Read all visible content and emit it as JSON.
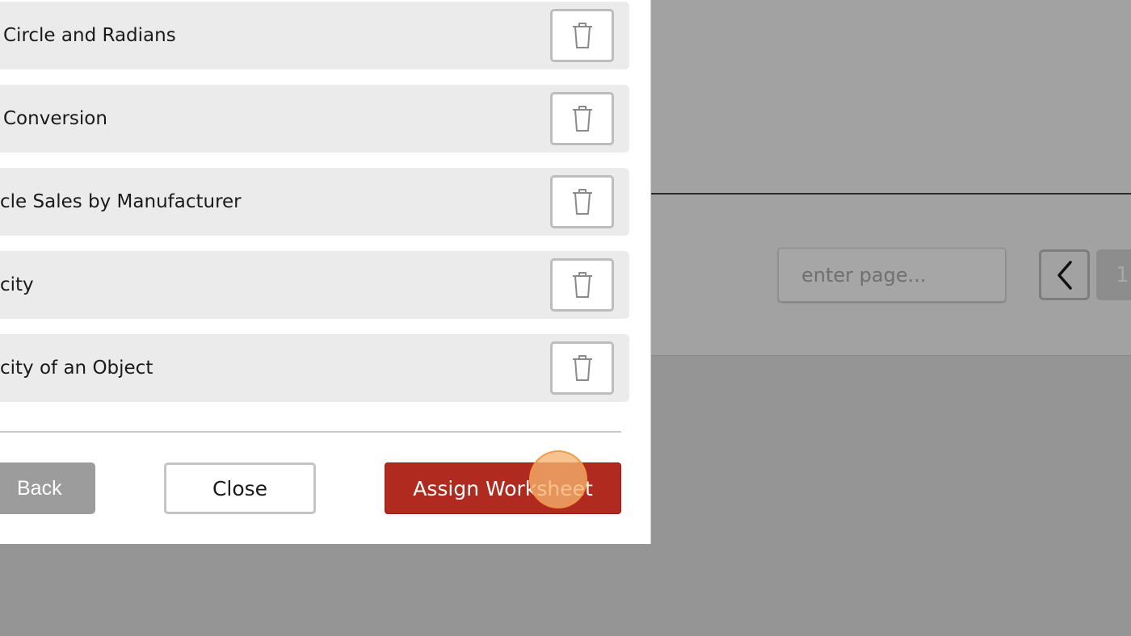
{
  "worksheets": [
    {
      "title": "Circle and Radians",
      "delete_icon": "trash-icon"
    },
    {
      "title": "Conversion",
      "delete_icon": "trash-icon"
    },
    {
      "title": "cle Sales by Manufacturer",
      "delete_icon": "trash-icon"
    },
    {
      "title": "city",
      "delete_icon": "trash-icon"
    },
    {
      "title": "city of an Object",
      "delete_icon": "trash-icon"
    }
  ],
  "footer": {
    "back_label": "Back",
    "close_label": "Close",
    "assign_label": "Assign Worksheet",
    "assign_color": "#b02a1f"
  },
  "pagination": {
    "page_input_placeholder": "enter page...",
    "prev_icon": "chevron-left-icon",
    "current_page": "1"
  }
}
